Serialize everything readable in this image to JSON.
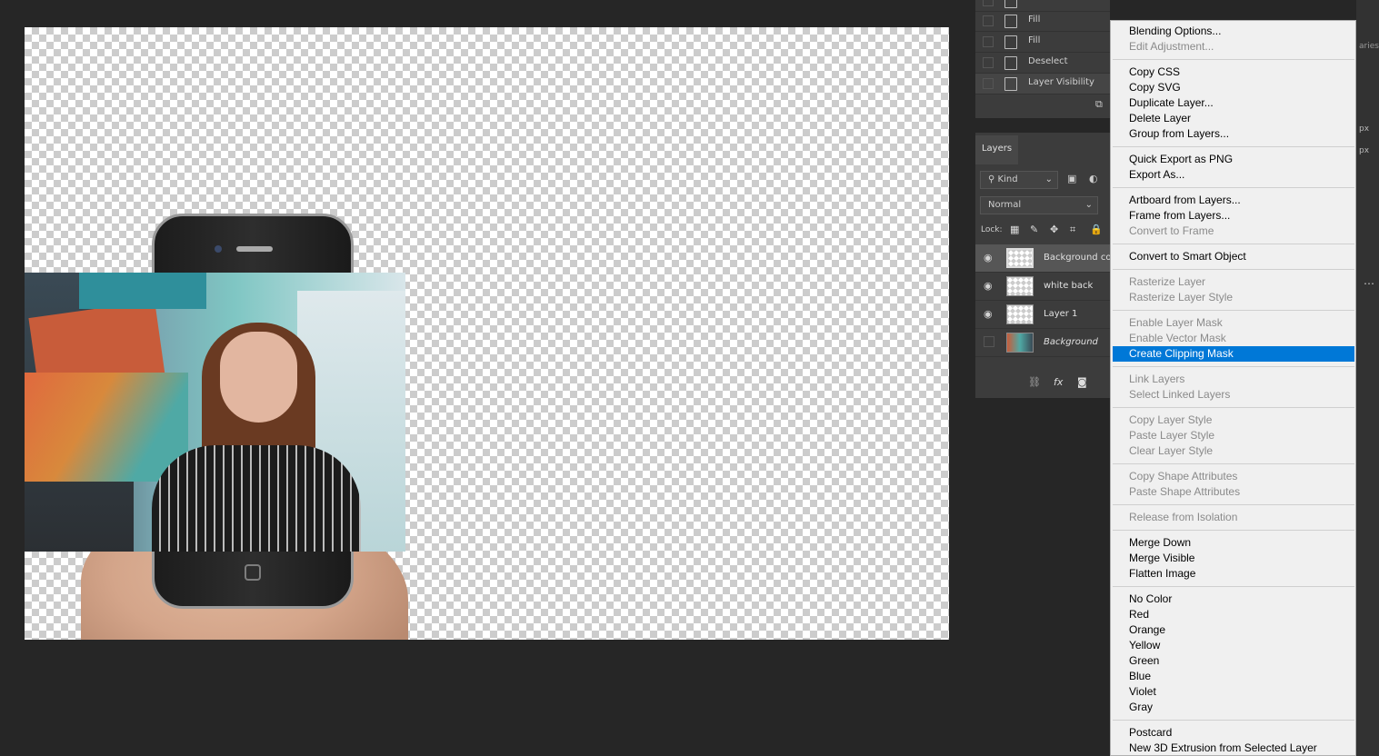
{
  "actions": [
    {
      "label": "Fill"
    },
    {
      "label": "Fill"
    },
    {
      "label": "Deselect"
    },
    {
      "label": "Layer Visibility"
    }
  ],
  "layers_panel": {
    "tab": "Layers",
    "kind_filter": "Kind",
    "blend_mode": "Normal",
    "lock_label": "Lock:",
    "layers": [
      {
        "name": "Background cop",
        "visible": true
      },
      {
        "name": "white back",
        "visible": true
      },
      {
        "name": "Layer 1",
        "visible": true
      },
      {
        "name": "Background",
        "visible": false
      }
    ]
  },
  "context_menu": {
    "groups": [
      [
        {
          "label": "Blending Options...",
          "enabled": true
        },
        {
          "label": "Edit Adjustment...",
          "enabled": false
        }
      ],
      [
        {
          "label": "Copy CSS",
          "enabled": true
        },
        {
          "label": "Copy SVG",
          "enabled": true
        },
        {
          "label": "Duplicate Layer...",
          "enabled": true
        },
        {
          "label": "Delete Layer",
          "enabled": true
        },
        {
          "label": "Group from Layers...",
          "enabled": true
        }
      ],
      [
        {
          "label": "Quick Export as PNG",
          "enabled": true
        },
        {
          "label": "Export As...",
          "enabled": true
        }
      ],
      [
        {
          "label": "Artboard from Layers...",
          "enabled": true
        },
        {
          "label": "Frame from Layers...",
          "enabled": true
        },
        {
          "label": "Convert to Frame",
          "enabled": false
        }
      ],
      [
        {
          "label": "Convert to Smart Object",
          "enabled": true
        }
      ],
      [
        {
          "label": "Rasterize Layer",
          "enabled": false
        },
        {
          "label": "Rasterize Layer Style",
          "enabled": false
        }
      ],
      [
        {
          "label": "Enable Layer Mask",
          "enabled": false
        },
        {
          "label": "Enable Vector Mask",
          "enabled": false
        },
        {
          "label": "Create Clipping Mask",
          "enabled": true,
          "selected": true
        }
      ],
      [
        {
          "label": "Link Layers",
          "enabled": false
        },
        {
          "label": "Select Linked Layers",
          "enabled": false
        }
      ],
      [
        {
          "label": "Copy Layer Style",
          "enabled": false
        },
        {
          "label": "Paste Layer Style",
          "enabled": false
        },
        {
          "label": "Clear Layer Style",
          "enabled": false
        }
      ],
      [
        {
          "label": "Copy Shape Attributes",
          "enabled": false
        },
        {
          "label": "Paste Shape Attributes",
          "enabled": false
        }
      ],
      [
        {
          "label": "Release from Isolation",
          "enabled": false
        }
      ],
      [
        {
          "label": "Merge Down",
          "enabled": true
        },
        {
          "label": "Merge Visible",
          "enabled": true
        },
        {
          "label": "Flatten Image",
          "enabled": true
        }
      ],
      [
        {
          "label": "No Color",
          "enabled": true
        },
        {
          "label": "Red",
          "enabled": true
        },
        {
          "label": "Orange",
          "enabled": true
        },
        {
          "label": "Yellow",
          "enabled": true
        },
        {
          "label": "Green",
          "enabled": true
        },
        {
          "label": "Blue",
          "enabled": true
        },
        {
          "label": "Violet",
          "enabled": true
        },
        {
          "label": "Gray",
          "enabled": true
        }
      ],
      [
        {
          "label": "Postcard",
          "enabled": true
        },
        {
          "label": "New 3D Extrusion from Selected Layer",
          "enabled": true
        }
      ]
    ]
  },
  "right_strip": {
    "text_1": "aries",
    "text_2": "px",
    "text_3": "px"
  },
  "colors": {
    "menu_highlight": "#0078d7",
    "workspace": "#262626",
    "panel": "#3c3c3c"
  }
}
